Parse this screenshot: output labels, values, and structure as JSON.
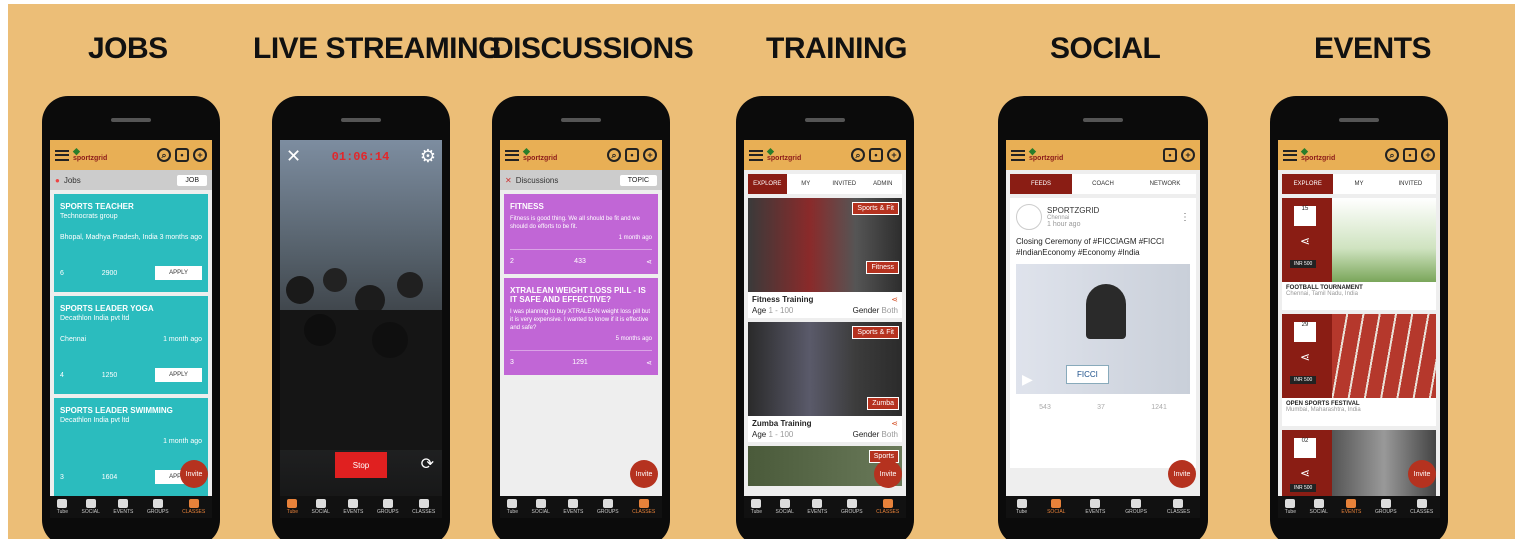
{
  "titles": [
    "JOBS",
    "LIVE STREAMING",
    "DISCUSSIONS",
    "TRAINING",
    "SOCIAL",
    "EVENTS"
  ],
  "app": {
    "logo_text": "sportzgrid",
    "invite_label": "Invite"
  },
  "nav": [
    "Tube",
    "SOCIAL",
    "EVENTS",
    "GROUPS",
    "CLASSES"
  ],
  "jobs": {
    "header": "Jobs",
    "toggle": "JOB",
    "cards": [
      {
        "title": "SPORTS TEACHER",
        "org": "Technocrats group",
        "location": "Bhopal, Madhya Pradesh, India",
        "ago": "3 months ago",
        "count": "6",
        "views": "2900",
        "apply": "APPLY"
      },
      {
        "title": "SPORTS LEADER YOGA",
        "org": "Decathlon India pvt ltd",
        "location": "Chennai",
        "ago": "1 month ago",
        "count": "4",
        "views": "1250",
        "apply": "APPLY"
      },
      {
        "title": "SPORTS LEADER SWIMMING",
        "org": "Decathlon India pvt ltd",
        "location": "",
        "ago": "1 month ago",
        "count": "3",
        "views": "1604",
        "apply": "APPLY"
      }
    ]
  },
  "live": {
    "timer": "01:06:14",
    "stop": "Stop"
  },
  "discussions": {
    "header": "Discussions",
    "toggle": "TOPIC",
    "cards": [
      {
        "title": "FITNESS",
        "body": "Fitness is good thing. We all should be fit and we should do efforts to be fit.",
        "ago": "1 month ago",
        "count": "2",
        "views": "433"
      },
      {
        "title": "XTRALEAN WEIGHT LOSS PILL - IS IT SAFE AND EFFECTIVE?",
        "body": "I was planning to buy XTRALEAN weight loss pill but it is very expensive. I wanted to know if it is effective and safe?",
        "ago": "5 months ago",
        "count": "3",
        "views": "1291"
      }
    ]
  },
  "training": {
    "tabs": [
      "EXPLORE",
      "MY",
      "INVITED",
      "ADMIN"
    ],
    "items": [
      {
        "name": "Fitness Training",
        "age_label": "Age",
        "age": "1 - 100",
        "gender_label": "Gender",
        "gender": "Both",
        "badge_top": "Sports & Fit",
        "badge_bottom": "Fitness"
      },
      {
        "name": "Zumba Training",
        "age_label": "Age",
        "age": "1 - 100",
        "gender_label": "Gender",
        "gender": "Both",
        "badge_top": "Sports & Fit",
        "badge_bottom": "Zumba"
      },
      {
        "name": "",
        "age_label": "",
        "age": "",
        "gender_label": "",
        "gender": "",
        "badge_top": "Sports",
        "badge_bottom": ""
      }
    ]
  },
  "social": {
    "tabs": [
      "FEEDS",
      "COACH",
      "NETWORK"
    ],
    "post": {
      "author": "SPORTZGRID",
      "location": "Chennai",
      "time": "1 hour ago",
      "text": "Closing Ceremony of #FICCIAGM #FICCI #IndianEconomy #Economy #India",
      "banner": "FICCI",
      "likes": "543",
      "comments": "37",
      "views": "1241"
    }
  },
  "events": {
    "tabs": [
      "EXPLORE",
      "MY",
      "INVITED"
    ],
    "items": [
      {
        "day": "15",
        "price": "INR 500",
        "name": "FOOTBALL TOURNAMENT",
        "location": "Chennai, Tamil Nadu, India"
      },
      {
        "day": "29",
        "price": "INR 500",
        "name": "OPEN SPORTS FESTIVAL",
        "location": "Mumbai, Maharashtra, India"
      },
      {
        "day": "02",
        "price": "INR 500",
        "name": "",
        "location": ""
      }
    ]
  },
  "colors": {
    "background": "#ECBE77",
    "appbar": "#E8AF55",
    "teal": "#2BBCBE",
    "purple": "#C166D6",
    "maroon": "#8A1D14",
    "invite": "#B5321F"
  }
}
